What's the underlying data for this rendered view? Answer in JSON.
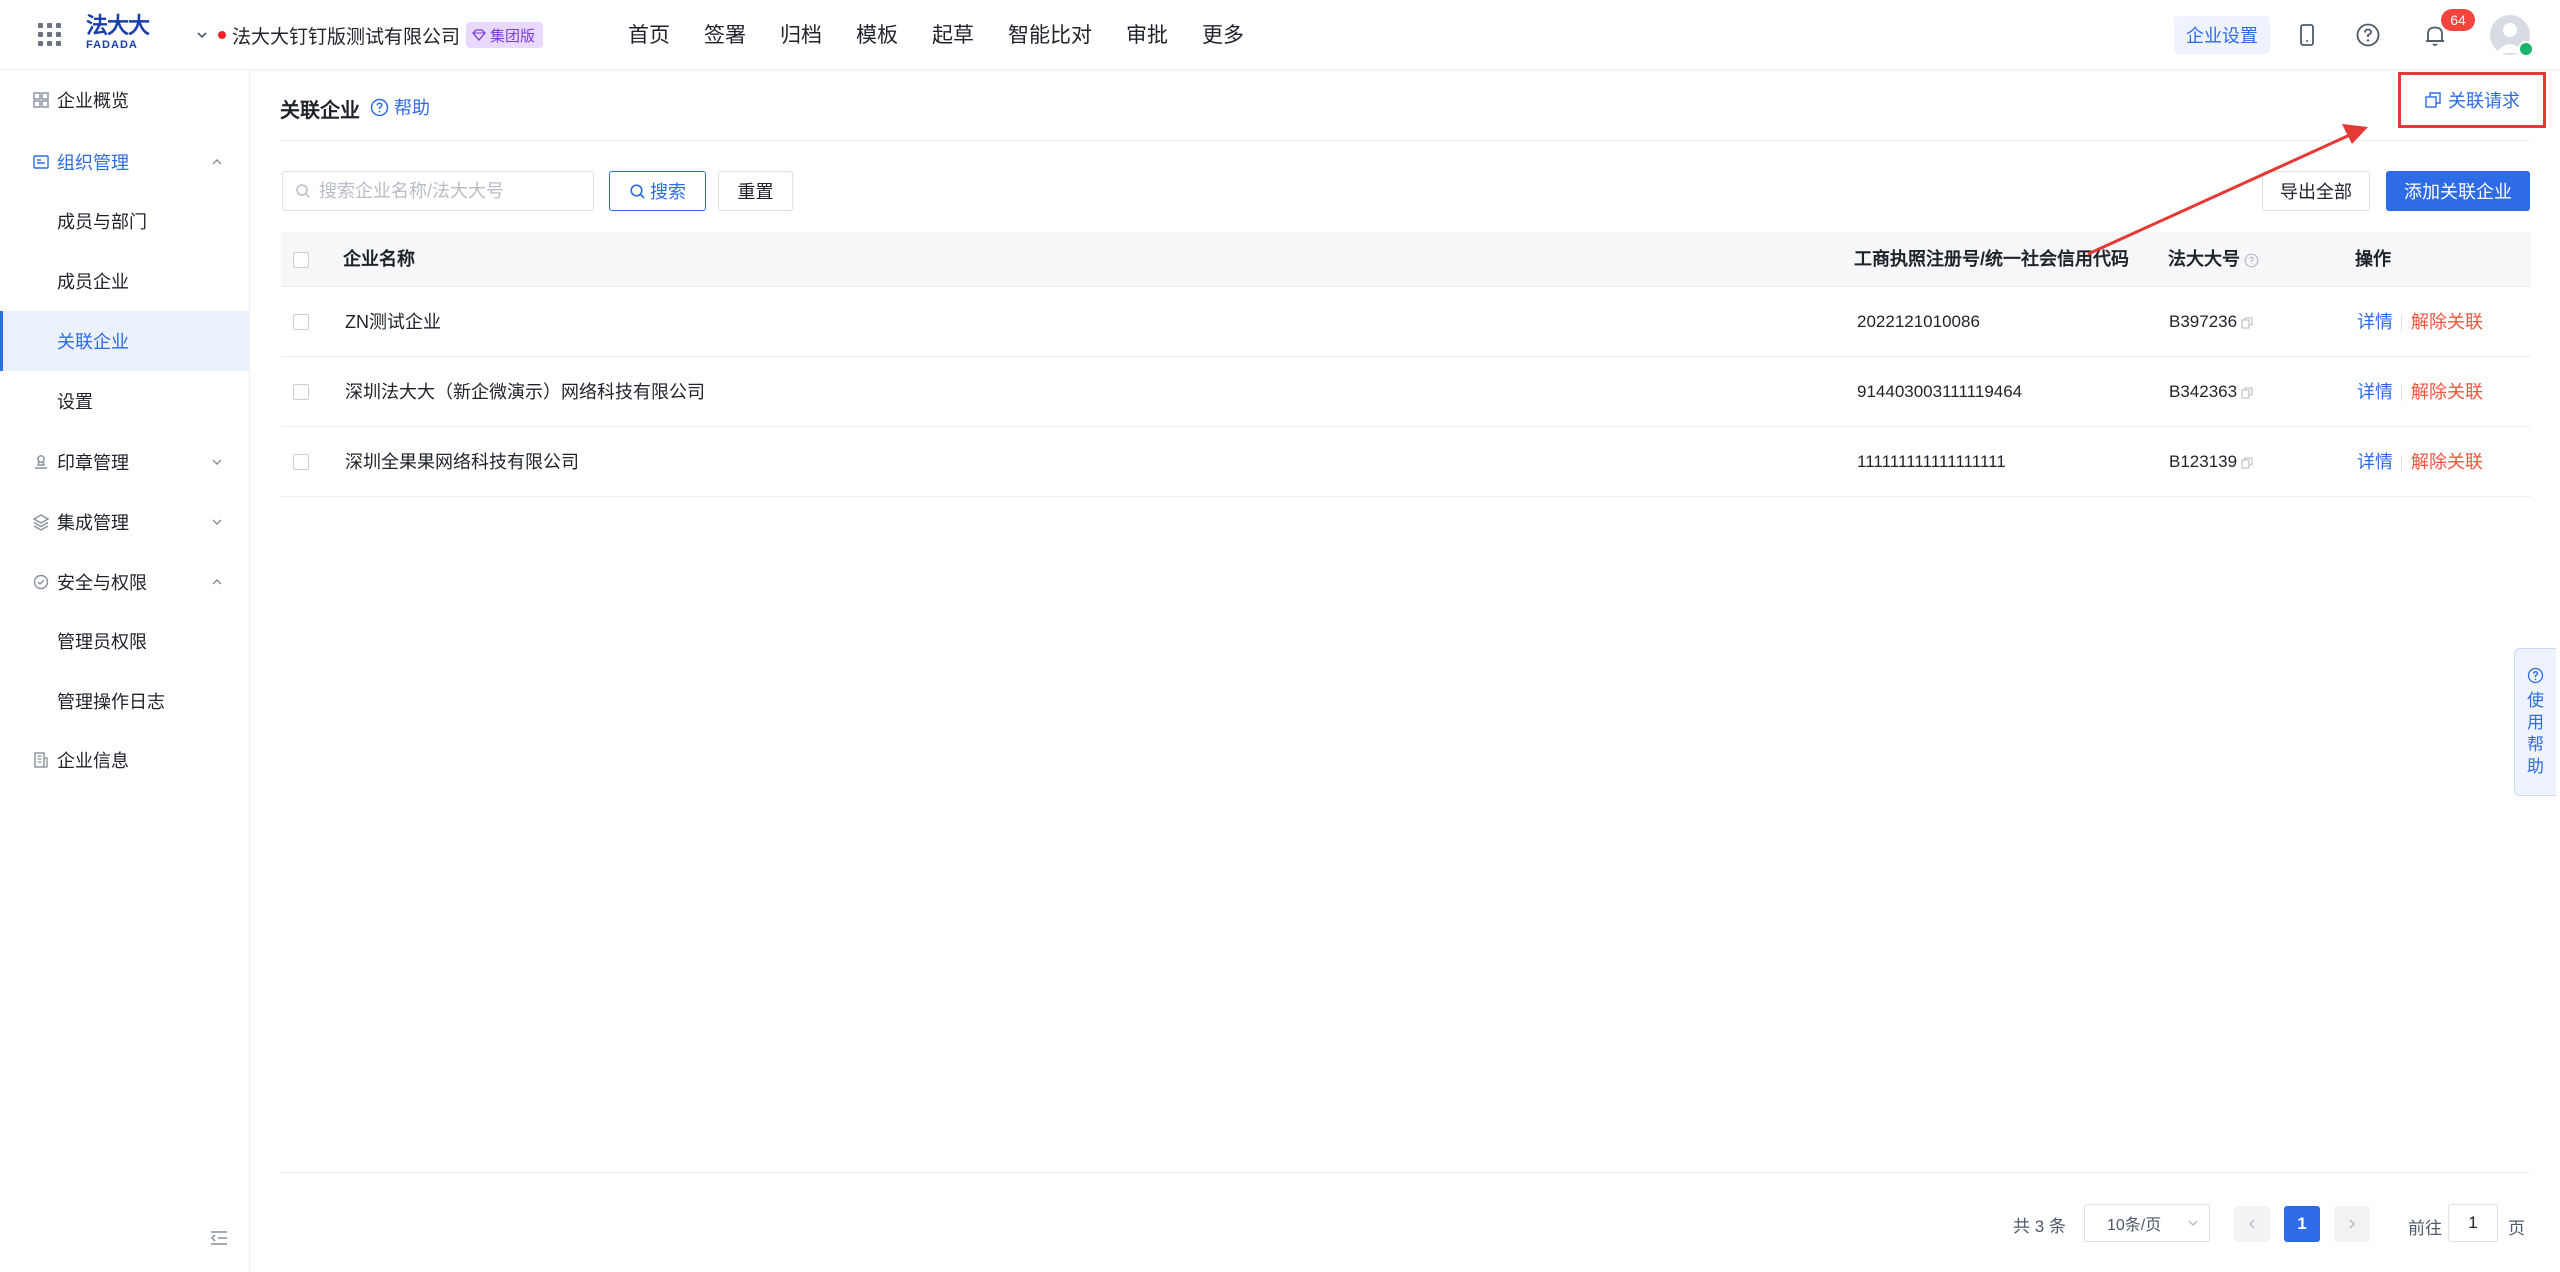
{
  "header": {
    "logo_zh": "法大大",
    "logo_en": "FADADA",
    "company_name": "法大大钉钉版测试有限公司",
    "edition_badge": "集团版",
    "nav": [
      "首页",
      "签署",
      "归档",
      "模板",
      "起草",
      "智能比对",
      "审批",
      "更多"
    ],
    "settings_button": "企业设置",
    "notification_count": "64",
    "icons": [
      "apps-grid-icon",
      "mobile-icon",
      "help-icon",
      "bell-icon",
      "avatar"
    ]
  },
  "sidebar": {
    "items": [
      {
        "label": "企业概览",
        "icon": "overview-icon"
      },
      {
        "label": "组织管理",
        "icon": "org-icon",
        "expanded": true
      },
      {
        "label": "成员与部门"
      },
      {
        "label": "成员企业"
      },
      {
        "label": "关联企业",
        "active": true
      },
      {
        "label": "设置"
      },
      {
        "label": "印章管理",
        "icon": "seal-icon"
      },
      {
        "label": "集成管理",
        "icon": "layers-icon"
      },
      {
        "label": "安全与权限",
        "icon": "security-icon",
        "expanded": true
      },
      {
        "label": "管理员权限"
      },
      {
        "label": "管理操作日志"
      },
      {
        "label": "企业信息",
        "icon": "company-info-icon"
      }
    ]
  },
  "page": {
    "title": "关联企业",
    "help": "帮助",
    "assoc_request": "关联请求",
    "search_placeholder": "搜索企业名称/法大大号",
    "search_button": "搜索",
    "reset_button": "重置",
    "export_button": "导出全部",
    "add_button": "添加关联企业"
  },
  "table": {
    "columns": [
      "企业名称",
      "工商执照注册号/统一社会信用代码",
      "法大大号",
      "操作"
    ],
    "rows": [
      {
        "name": "ZN测试企业",
        "code": "2022121010086",
        "fdd_id": "B397236"
      },
      {
        "name": "深圳法大大（新企微演示）网络科技有限公司",
        "code": "914403003111119464",
        "fdd_id": "B342363"
      },
      {
        "name": "深圳全果果网络科技有限公司",
        "code": "111111111111111111",
        "fdd_id": "B123139"
      }
    ],
    "action_detail": "详情",
    "action_unlink": "解除关联"
  },
  "pagination": {
    "total": "共 3 条",
    "page_size": "10条/页",
    "current_page": "1",
    "goto_label": "前往",
    "goto_value": "1",
    "goto_suffix": "页"
  },
  "float_help": "使用帮助",
  "colors": {
    "primary": "#2e6be6",
    "danger": "#f5533d",
    "annotation": "#e53935",
    "badge_bg": "#e9d9ff"
  }
}
